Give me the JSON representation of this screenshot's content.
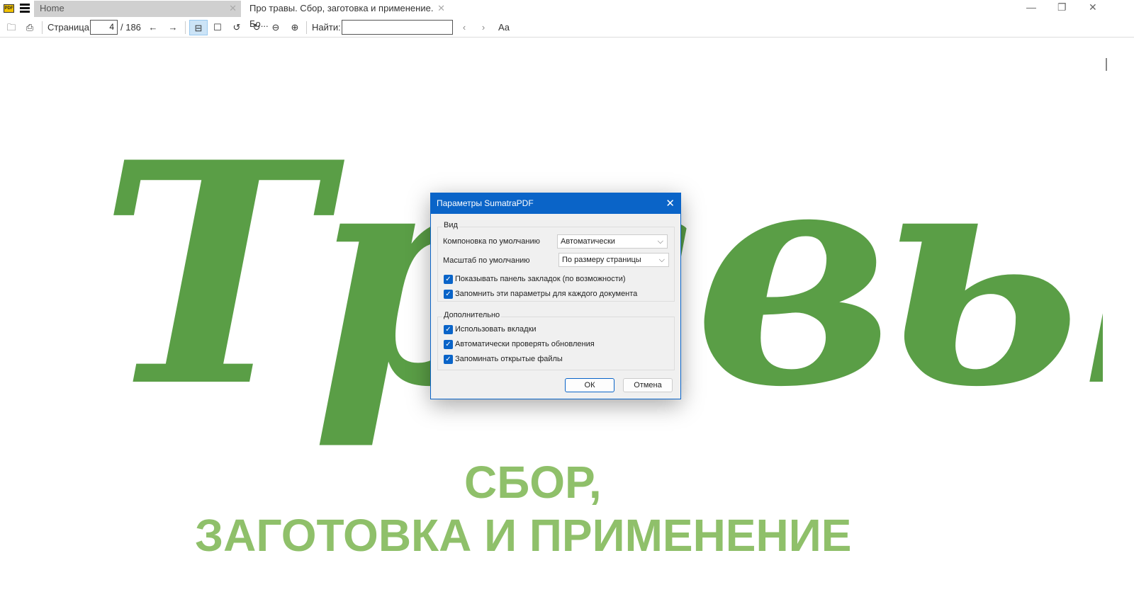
{
  "app": {
    "logo_text": "PDF"
  },
  "tabs": [
    {
      "label": "Home"
    },
    {
      "label": "Про травы. Сбор, заготовка и применение. Бо..."
    }
  ],
  "toolbar": {
    "page_label": "Страница:",
    "page_value": "4",
    "page_total": "/ 186",
    "find_label": "Найти:",
    "find_value": "",
    "font_icon_text": "Aa"
  },
  "document": {
    "title_script": "Травы",
    "subtitle_line1": "СБОР,",
    "subtitle_line2": "ЗАГОТОВКА И ПРИМЕНЕНИЕ",
    "colors": {
      "script": "#5a9e46",
      "subtitle": "#8fc06a"
    }
  },
  "dialog": {
    "title": "Параметры SumatraPDF",
    "view_group": "Вид",
    "layout_label": "Компоновка по умолчанию",
    "layout_value": "Автоматически",
    "zoom_label": "Масштаб по умолчанию",
    "zoom_value": "По размеру страницы",
    "view_checks": [
      {
        "label": "Показывать панель закладок (по возможности)",
        "checked": true
      },
      {
        "label": "Запомнить эти параметры для каждого документа",
        "checked": true
      }
    ],
    "advanced_group": "Дополнительно",
    "advanced_checks": [
      {
        "label": "Использовать вкладки",
        "checked": true
      },
      {
        "label": "Автоматически проверять обновления",
        "checked": true
      },
      {
        "label": "Запоминать открытые файлы",
        "checked": true
      }
    ],
    "ok": "ОК",
    "cancel": "Отмена",
    "accent": "#0a64c8"
  }
}
